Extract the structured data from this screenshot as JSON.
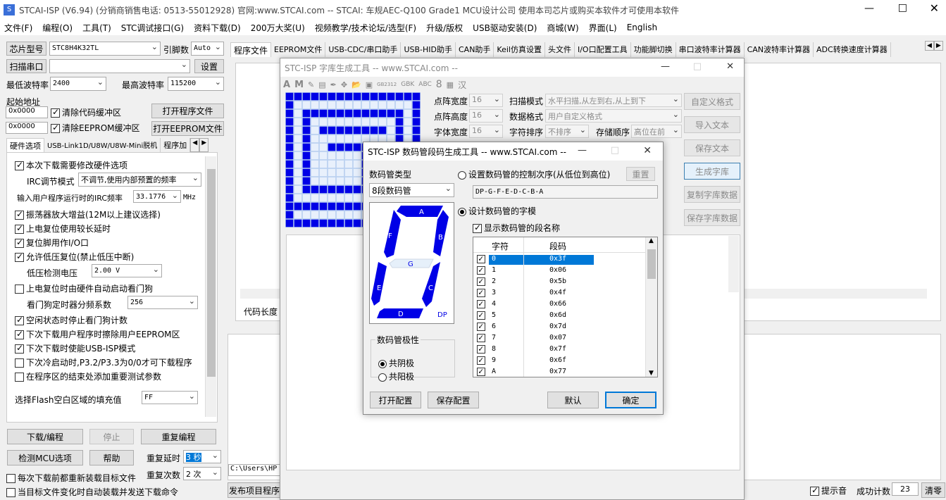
{
  "title": "STCAI-ISP (V6.94) (分销商销售电话: 0513-55012928) 官网:www.STCAI.com  -- STCAI: 车规AEC-Q100 Grade1 MCU设计公司 使用本司芯片或购买本软件才可使用本软件",
  "menu": [
    "文件(F)",
    "编程(O)",
    "工具(T)",
    "STC调试接口(G)",
    "资料下载(D)",
    "200万大奖(U)",
    "视频教学/技术论坛/选型(F)",
    "升级/版权",
    "USB驱动安装(D)",
    "商城(W)",
    "界面(L)",
    "English"
  ],
  "left": {
    "chip_label": "芯片型号",
    "chip_value": "STC8H4K32TL",
    "pin_label": "引脚数",
    "pin_value": "Auto",
    "scan_label": "扫描串口",
    "settings_btn": "设置",
    "min_baud_label": "最低波特率",
    "min_baud": "2400",
    "max_baud_label": "最高波特率",
    "max_baud": "115200",
    "start_addr_label": "起始地址",
    "addr1": "0x0000",
    "clear_code": "清除代码缓冲区",
    "open_prog": "打开程序文件",
    "addr2": "0x0000",
    "clear_eeprom": "清除EEPROM缓冲区",
    "open_eeprom": "打开EEPROM文件",
    "tabs": [
      "硬件选项",
      "USB-Link1D/U8W/U8W-Mini脱机",
      "程序加"
    ],
    "opts": [
      {
        "label": "本次下载需要修改硬件选项",
        "checked": true
      },
      {
        "label": "振荡器放大增益(12M以上建议选择)",
        "checked": true
      },
      {
        "label": "上电复位使用较长延时",
        "checked": true
      },
      {
        "label": "复位脚用作I/O口",
        "checked": true
      },
      {
        "label": "允许低压复位(禁止低压中断)",
        "checked": true
      },
      {
        "label": "上电复位时由硬件自动启动看门狗",
        "checked": false
      },
      {
        "label": "空闲状态时停止看门狗计数",
        "checked": true
      },
      {
        "label": "下次下载用户程序时擦除用户EEPROM区",
        "checked": true
      },
      {
        "label": "下次下载时使能USB-ISP模式",
        "checked": true
      },
      {
        "label": "下次冷启动时,P3.2/P3.3为0/0才可下载程序",
        "checked": false
      },
      {
        "label": "在程序区的结束处添加重要测试参数",
        "checked": false
      }
    ],
    "irc_mode_label": "IRC调节模式",
    "irc_mode": "不调节,使用内部预置的频率",
    "irc_freq_label": "输入用户程序运行时的IRC频率",
    "irc_freq": "33.1776",
    "mhz": "MHz",
    "lvd_label": "低压检测电压",
    "lvd": "2.00 V",
    "wdt_label": "看门狗定时器分频系数",
    "wdt": "256",
    "fill_label": "选择Flash空白区域的填充值",
    "fill": "FF",
    "download_btn": "下载/编程",
    "stop_btn": "停止",
    "reprog_btn": "重复编程",
    "check_btn": "检测MCU选项",
    "help_btn": "帮助",
    "delay_label": "重复延时",
    "delay": "3 秒",
    "count_label": "重复次数",
    "count": "2 次",
    "reload_chk": "每次下载前都重新装载目标文件",
    "auto_chk": "当目标文件变化时自动装载并发送下载命令"
  },
  "right": {
    "tabs": [
      "程序文件",
      "EEPROM文件",
      "USB-CDC/串口助手",
      "USB-HID助手",
      "CAN助手",
      "Keil仿真设置",
      "头文件",
      "I/O口配置工具",
      "功能脚切换",
      "串口波特率计算器",
      "CAN波特率计算器",
      "ADC转换速度计算器"
    ],
    "code_len": "代码长度",
    "path": "C:\\Users\\HP",
    "publish": "发布项目程序",
    "beep": "提示音",
    "success_label": "成功计数",
    "success": "23",
    "clear": "清零"
  },
  "font_tool": {
    "title": "STC-ISP 字库生成工具 -- www.STCAI.com --",
    "lattice_w_label": "点阵宽度",
    "lattice_w": "16",
    "lattice_h_label": "点阵高度",
    "lattice_h": "16",
    "font_w_label": "字体宽度",
    "font_w": "16",
    "scan_label": "扫描模式",
    "scan": "水平扫描,从左到右,从上到下",
    "fmt_label": "数据格式",
    "fmt": "用户自定义格式",
    "order_label": "字符排序",
    "order": "不排序",
    "store_label": "存储顺序",
    "store": "高位在前",
    "btns": [
      "自定义格式",
      "导入文本",
      "保存文本",
      "生成字库",
      "复制字库数据",
      "保存字库数据"
    ],
    "toolbar": [
      "A",
      "M",
      "GB2312",
      "GBK",
      "ABC",
      "8",
      "汉"
    ]
  },
  "seg_tool": {
    "title": "STC-ISP 数码管段码生成工具 -- www.STCAI.com --",
    "type_label": "数码管类型",
    "type": "8段数码管",
    "order_radio": "设置数码管的控制次序(从低位到高位)",
    "reset_btn": "重置",
    "order_value": "DP-G-F-E-D-C-B-A",
    "design_radio": "设计数码管的字模",
    "show_names": "显示数码管的段名称",
    "col_char": "字符",
    "col_code": "段码",
    "rows": [
      [
        "0",
        "0x3f"
      ],
      [
        "1",
        "0x06"
      ],
      [
        "2",
        "0x5b"
      ],
      [
        "3",
        "0x4f"
      ],
      [
        "4",
        "0x66"
      ],
      [
        "5",
        "0x6d"
      ],
      [
        "6",
        "0x7d"
      ],
      [
        "7",
        "0x07"
      ],
      [
        "8",
        "0x7f"
      ],
      [
        "9",
        "0x6f"
      ],
      [
        "A",
        "0x77"
      ]
    ],
    "polarity_label": "数码管极性",
    "cathode": "共阴极",
    "anode": "共阳极",
    "open_cfg": "打开配置",
    "save_cfg": "保存配置",
    "default_btn": "默认",
    "ok_btn": "确定",
    "seg_labels": [
      "A",
      "B",
      "C",
      "D",
      "E",
      "F",
      "G",
      "DP"
    ]
  }
}
